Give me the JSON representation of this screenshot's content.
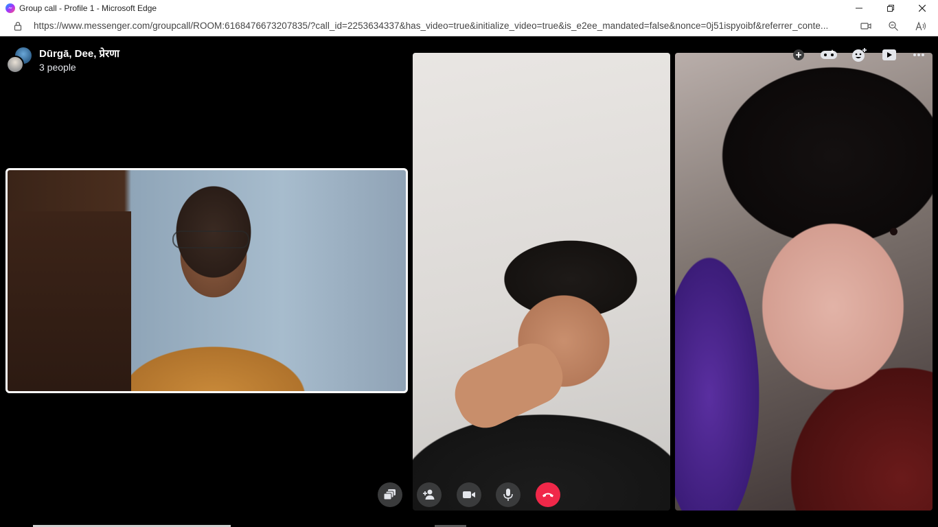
{
  "window": {
    "title": "Group call - Profile 1 - Microsoft Edge"
  },
  "address_bar": {
    "url": "https://www.messenger.com/groupcall/ROOM:6168476673207835/?call_id=2253634337&has_video=true&initialize_video=true&is_e2ee_mandated=false&nonce=0j51ispyoibf&referrer_conte..."
  },
  "call": {
    "participants_names": "Dūrgā, Dee, प्रेरणा",
    "participant_count": "3 people",
    "top_controls": [
      "add-icon",
      "effects-icon",
      "reactions-icon",
      "watch-together-icon",
      "more-options-icon"
    ],
    "bottom_controls": [
      "share-screen-icon",
      "add-person-icon",
      "video-camera-icon",
      "microphone-icon",
      "end-call-icon"
    ],
    "colors": {
      "end_call": "#f02849",
      "control_bg": "#3a3b3c",
      "self_border": "#ffffff"
    }
  }
}
